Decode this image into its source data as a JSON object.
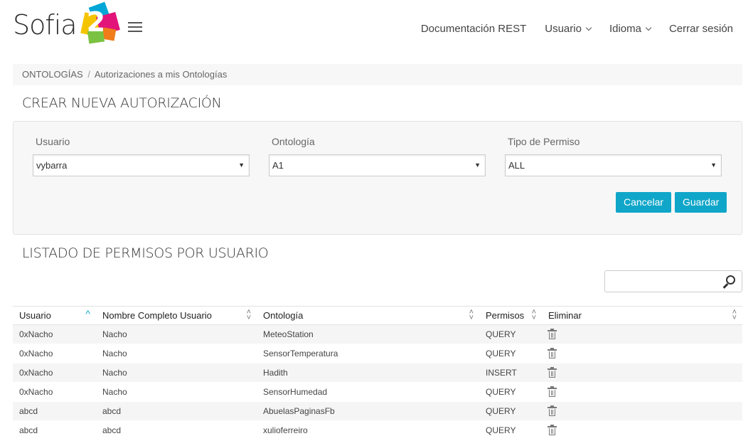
{
  "header": {
    "logo_text": "Sofia",
    "logo_number": "2",
    "nav": [
      {
        "label": "Documentación REST",
        "dropdown": false
      },
      {
        "label": "Usuario",
        "dropdown": true
      },
      {
        "label": "Idioma",
        "dropdown": true
      },
      {
        "label": "Cerrar sesión",
        "dropdown": false
      }
    ]
  },
  "breadcrumb": {
    "root": "ONTOLOGÍAS",
    "separator": "/",
    "current": "Autorizaciones a mis Ontologías"
  },
  "create": {
    "title": "CREAR NUEVA AUTORIZACIÓN",
    "fields": {
      "usuario": {
        "label": "Usuario",
        "value": "vybarra"
      },
      "ontologia": {
        "label": "Ontología",
        "value": "A1"
      },
      "permiso": {
        "label": "Tipo de Permiso",
        "value": "ALL"
      }
    },
    "cancel_label": "Cancelar",
    "save_label": "Guardar"
  },
  "list": {
    "title": "LISTADO DE PERMISOS POR USUARIO",
    "search_value": "",
    "columns": [
      "Usuario",
      "Nombre Completo Usuario",
      "Ontología",
      "Permisos",
      "Eliminar"
    ],
    "rows": [
      {
        "usuario": "0xNacho",
        "nombre": "Nacho",
        "ontologia": "MeteoStation",
        "permisos": "QUERY"
      },
      {
        "usuario": "0xNacho",
        "nombre": "Nacho",
        "ontologia": "SensorTemperatura",
        "permisos": "QUERY"
      },
      {
        "usuario": "0xNacho",
        "nombre": "Nacho",
        "ontologia": "Hadith",
        "permisos": "INSERT"
      },
      {
        "usuario": "0xNacho",
        "nombre": "Nacho",
        "ontologia": "SensorHumedad",
        "permisos": "QUERY"
      },
      {
        "usuario": "abcd",
        "nombre": "abcd",
        "ontologia": "AbuelasPaginasFb",
        "permisos": "QUERY"
      },
      {
        "usuario": "abcd",
        "nombre": "abcd",
        "ontologia": "xulioferreiro",
        "permisos": "QUERY"
      }
    ]
  },
  "colors": {
    "accent": "#0fa6c9",
    "logo_yellow": "#f5c400",
    "logo_magenta": "#e2147a",
    "logo_cyan": "#00a7d6",
    "logo_green": "#7cc242",
    "logo_orange": "#f07d1a"
  }
}
